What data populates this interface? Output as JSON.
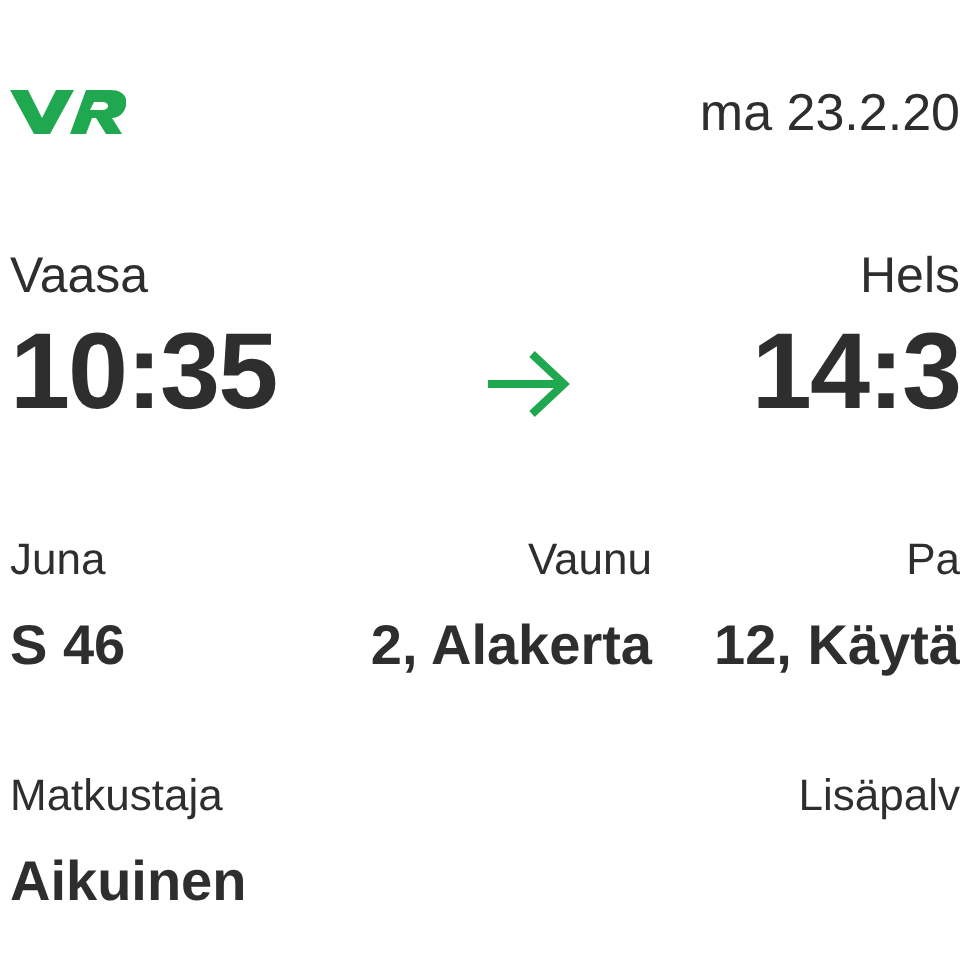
{
  "header": {
    "date": "ma 23.2.20"
  },
  "journey": {
    "from": {
      "station": "Vaasa",
      "time": "10:35"
    },
    "to": {
      "station": "Hels",
      "time": "14:3"
    }
  },
  "details": [
    {
      "label": "Juna",
      "value": "S 46"
    },
    {
      "label": "Vaunu",
      "value": "2, Alakerta"
    },
    {
      "label": "Pa",
      "value": "12, Käytä"
    }
  ],
  "passenger": {
    "label": "Matkustaja",
    "value": "Aikuinen"
  },
  "extras": {
    "label": "Lisäpalv"
  }
}
